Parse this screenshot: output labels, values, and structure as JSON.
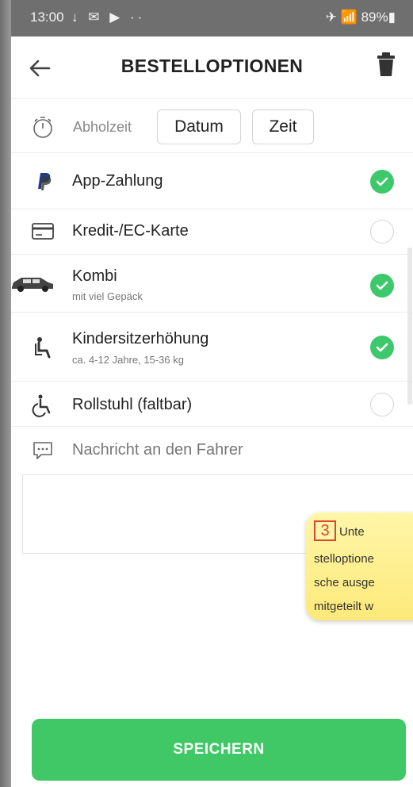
{
  "status_bar": {
    "time": "13:00",
    "left_icons": "↓ ✉ ▶ ··",
    "right": "✈ 📶 89%▮"
  },
  "header": {
    "title": "BESTELLOPTIONEN"
  },
  "pickup": {
    "label": "Abholzeit",
    "date_button": "Datum",
    "time_button": "Zeit"
  },
  "options": [
    {
      "label": "App-Zahlung",
      "sub": "",
      "checked": true
    },
    {
      "label": "Kredit-/EC-Karte",
      "sub": "",
      "checked": false
    },
    {
      "label": "Kombi",
      "sub": "mit viel Gepäck",
      "checked": true
    },
    {
      "label": "Kindersitzerhöhung",
      "sub": "ca. 4-12 Jahre, 15-36 kg",
      "checked": true
    },
    {
      "label": "Rollstuhl (faltbar)",
      "sub": "",
      "checked": false
    }
  ],
  "message": {
    "label": "Nachricht an den Fahrer",
    "value": ""
  },
  "note": {
    "number": "3",
    "line1": "Unte",
    "line2": "stelloptione",
    "line3": "sche ausge",
    "line4": "mitgeteilt w"
  },
  "save_button": "SPEICHERN",
  "colors": {
    "accent": "#3fc865",
    "status_bar": "#6f6f6f"
  }
}
